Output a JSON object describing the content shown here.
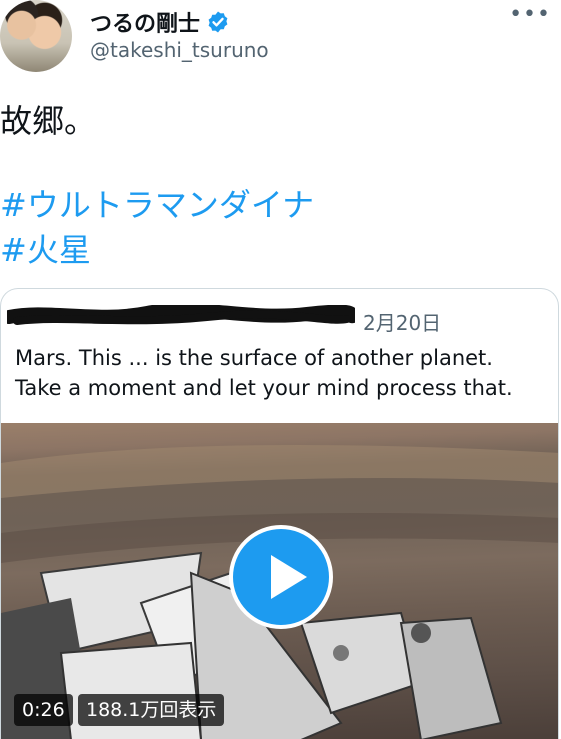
{
  "author": {
    "display_name": "つるの剛士",
    "handle": "@takeshi_tsuruno",
    "verified_color": "#1d9bf0"
  },
  "menu_icon": "more-horizontal-icon",
  "tweet": {
    "text": "故郷。",
    "hashtags": [
      "#ウルトラマンダイナ",
      "#火星"
    ]
  },
  "quoted_tweet": {
    "date": "2月20日",
    "text_line1": "Mars. This ... is the surface of another planet.",
    "text_line2": "Take a moment and let your mind process that."
  },
  "video": {
    "duration": "0:26",
    "views": "188.1万回表示",
    "play_icon": "play-icon"
  },
  "colors": {
    "accent": "#1d9bf0",
    "secondary_text": "#536471",
    "border": "#cfd9de"
  }
}
